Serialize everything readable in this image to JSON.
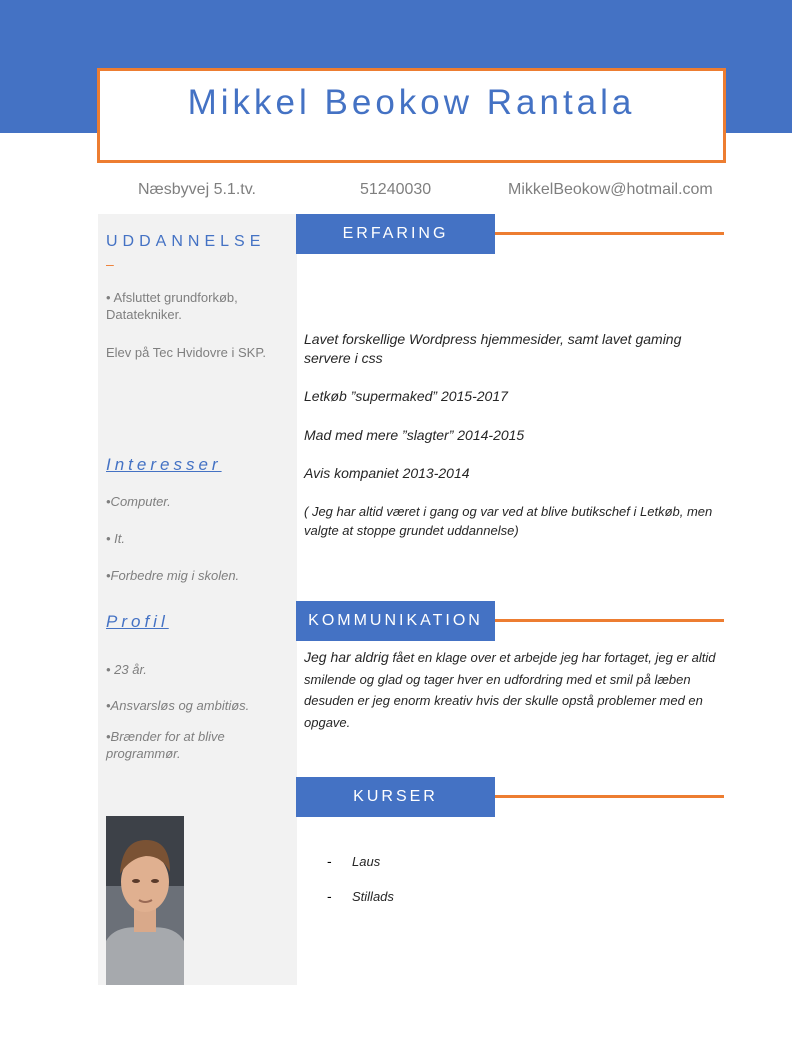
{
  "header": {
    "name": "Mikkel Beokow Rantala",
    "address": "Næsbyvej 5.1.tv.",
    "phone": "51240030",
    "email": "MikkelBeokow@hotmail.com"
  },
  "sidebar": {
    "education": {
      "title": "UDDANNELSE",
      "dash": "–",
      "items": [
        "• Afsluttet grundforkøb, Datatekniker.",
        "Elev på Tec Hvidovre i SKP."
      ]
    },
    "interests": {
      "title": "Interesser",
      "items": [
        "•Computer.",
        "• It.",
        "•Forbedre mig i skolen."
      ]
    },
    "profile": {
      "title": "Profil",
      "items": [
        "• 23 år.",
        "•Ansvarsløs og ambitiøs.",
        "•Brænder for at blive programmør."
      ]
    }
  },
  "main": {
    "experience": {
      "title": "ERFARING",
      "items": [
        "Lavet forskellige Wordpress hjemmesider, samt lavet gaming servere i css",
        "Letkøb ”supermaked” 2015-2017",
        "Mad med mere ”slagter” 2014-2015",
        "Avis kompaniet  2013-2014",
        "( Jeg har altid været i gang og var ved at blive butikschef i Letkøb, men valgte at stoppe grundet uddannelse)"
      ]
    },
    "communication": {
      "title": "KOMMUNIKATION",
      "lead": "Jeg har aldrig",
      "text": " fået en klage over et arbejde jeg har fortaget, jeg er altid smilende og glad og tager hver en udfordring med et smil på læben desuden er jeg enorm kreativ hvis der skulle opstå problemer med en opgave."
    },
    "courses": {
      "title": "KURSER",
      "bullet": "-",
      "items": [
        "Laus",
        "Stillads"
      ]
    }
  },
  "colors": {
    "accent_blue": "#4472c4",
    "accent_orange": "#ed7d31",
    "sidebar_bg": "#f2f2f2"
  },
  "icons": {
    "photo": "profile-photo"
  }
}
